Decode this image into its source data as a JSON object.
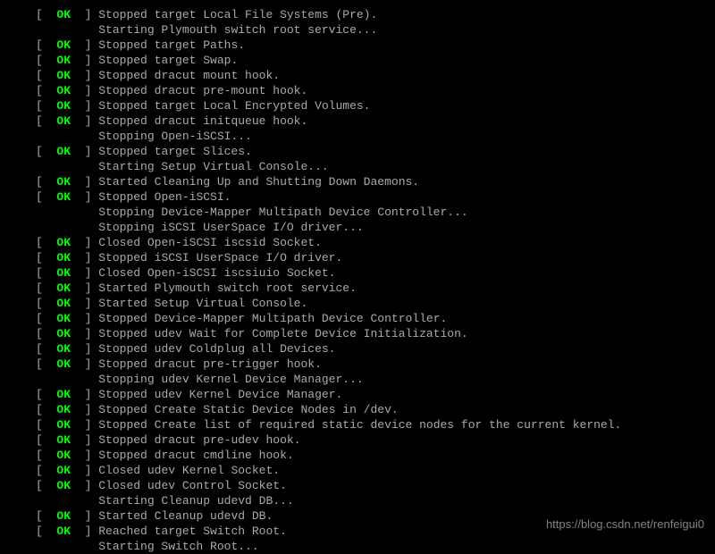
{
  "lines": [
    {
      "status": "OK",
      "text": "Stopped target Local File Systems (Pre)."
    },
    {
      "status": null,
      "text": "Starting Plymouth switch root service..."
    },
    {
      "status": "OK",
      "text": "Stopped target Paths."
    },
    {
      "status": "OK",
      "text": "Stopped target Swap."
    },
    {
      "status": "OK",
      "text": "Stopped dracut mount hook."
    },
    {
      "status": "OK",
      "text": "Stopped dracut pre-mount hook."
    },
    {
      "status": "OK",
      "text": "Stopped target Local Encrypted Volumes."
    },
    {
      "status": "OK",
      "text": "Stopped dracut initqueue hook."
    },
    {
      "status": null,
      "text": "Stopping Open-iSCSI..."
    },
    {
      "status": "OK",
      "text": "Stopped target Slices."
    },
    {
      "status": null,
      "text": "Starting Setup Virtual Console..."
    },
    {
      "status": "OK",
      "text": "Started Cleaning Up and Shutting Down Daemons."
    },
    {
      "status": "OK",
      "text": "Stopped Open-iSCSI."
    },
    {
      "status": null,
      "text": "Stopping Device-Mapper Multipath Device Controller..."
    },
    {
      "status": null,
      "text": "Stopping iSCSI UserSpace I/O driver..."
    },
    {
      "status": "OK",
      "text": "Closed Open-iSCSI iscsid Socket."
    },
    {
      "status": "OK",
      "text": "Stopped iSCSI UserSpace I/O driver."
    },
    {
      "status": "OK",
      "text": "Closed Open-iSCSI iscsiuio Socket."
    },
    {
      "status": "OK",
      "text": "Started Plymouth switch root service."
    },
    {
      "status": "OK",
      "text": "Started Setup Virtual Console."
    },
    {
      "status": "OK",
      "text": "Stopped Device-Mapper Multipath Device Controller."
    },
    {
      "status": "OK",
      "text": "Stopped udev Wait for Complete Device Initialization."
    },
    {
      "status": "OK",
      "text": "Stopped udev Coldplug all Devices."
    },
    {
      "status": "OK",
      "text": "Stopped dracut pre-trigger hook."
    },
    {
      "status": null,
      "text": "Stopping udev Kernel Device Manager..."
    },
    {
      "status": "OK",
      "text": "Stopped udev Kernel Device Manager."
    },
    {
      "status": "OK",
      "text": "Stopped Create Static Device Nodes in /dev."
    },
    {
      "status": "OK",
      "text": "Stopped Create list of required static device nodes for the current kernel."
    },
    {
      "status": "OK",
      "text": "Stopped dracut pre-udev hook."
    },
    {
      "status": "OK",
      "text": "Stopped dracut cmdline hook."
    },
    {
      "status": "OK",
      "text": "Closed udev Kernel Socket."
    },
    {
      "status": "OK",
      "text": "Closed udev Control Socket."
    },
    {
      "status": null,
      "text": "Starting Cleanup udevd DB..."
    },
    {
      "status": "OK",
      "text": "Started Cleanup udevd DB."
    },
    {
      "status": "OK",
      "text": "Reached target Switch Root."
    },
    {
      "status": null,
      "text": "Starting Switch Root..."
    }
  ],
  "watermark": "https://blog.csdn.net/renfeigui0"
}
